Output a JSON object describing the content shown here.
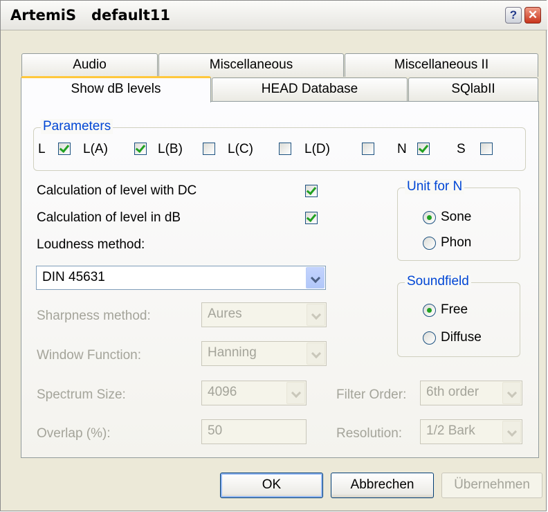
{
  "window": {
    "title": "ArtemiS   default11",
    "help_glyph": "?",
    "close_glyph": "✕"
  },
  "tabs": {
    "row1": [
      "Audio",
      "Miscellaneous",
      "Miscellaneous II"
    ],
    "row2": [
      "Show dB levels",
      "HEAD Database",
      "SQlabII"
    ],
    "active": "Show dB levels"
  },
  "parameters": {
    "legend": "Parameters",
    "items": [
      {
        "label": "L",
        "checked": true
      },
      {
        "label": "L(A)",
        "checked": true
      },
      {
        "label": "L(B)",
        "checked": false
      },
      {
        "label": "L(C)",
        "checked": false
      },
      {
        "label": "L(D)",
        "checked": false
      },
      {
        "label": "N",
        "checked": true
      },
      {
        "label": "S",
        "checked": false
      }
    ]
  },
  "options": {
    "calc_dc_label": "Calculation of level with DC",
    "calc_dc_checked": true,
    "calc_db_label": "Calculation of level in dB",
    "calc_db_checked": true
  },
  "loudness": {
    "label": "Loudness method:",
    "value": "DIN 45631"
  },
  "sharpness": {
    "label": "Sharpness method:",
    "value": "Aures"
  },
  "window_function": {
    "label": "Window Function:",
    "value": "Hanning"
  },
  "spectrum_size": {
    "label": "Spectrum Size:",
    "value": "4096"
  },
  "overlap": {
    "label": "Overlap (%):",
    "value": "50"
  },
  "filter_order": {
    "label": "Filter Order:",
    "value": "6th order"
  },
  "resolution": {
    "label": "Resolution:",
    "value": "1/2 Bark"
  },
  "unit_for_n": {
    "legend": "Unit for N",
    "options": [
      "Sone",
      "Phon"
    ],
    "selected": "Sone"
  },
  "soundfield": {
    "legend": "Soundfield",
    "options": [
      "Free",
      "Diffuse"
    ],
    "selected": "Free"
  },
  "buttons": {
    "ok": "OK",
    "cancel": "Abbrechen",
    "apply": "Übernehmen"
  },
  "colors": {
    "accent": "#0046d5",
    "check": "#21a121",
    "tab_highlight": "#ffc83c"
  }
}
